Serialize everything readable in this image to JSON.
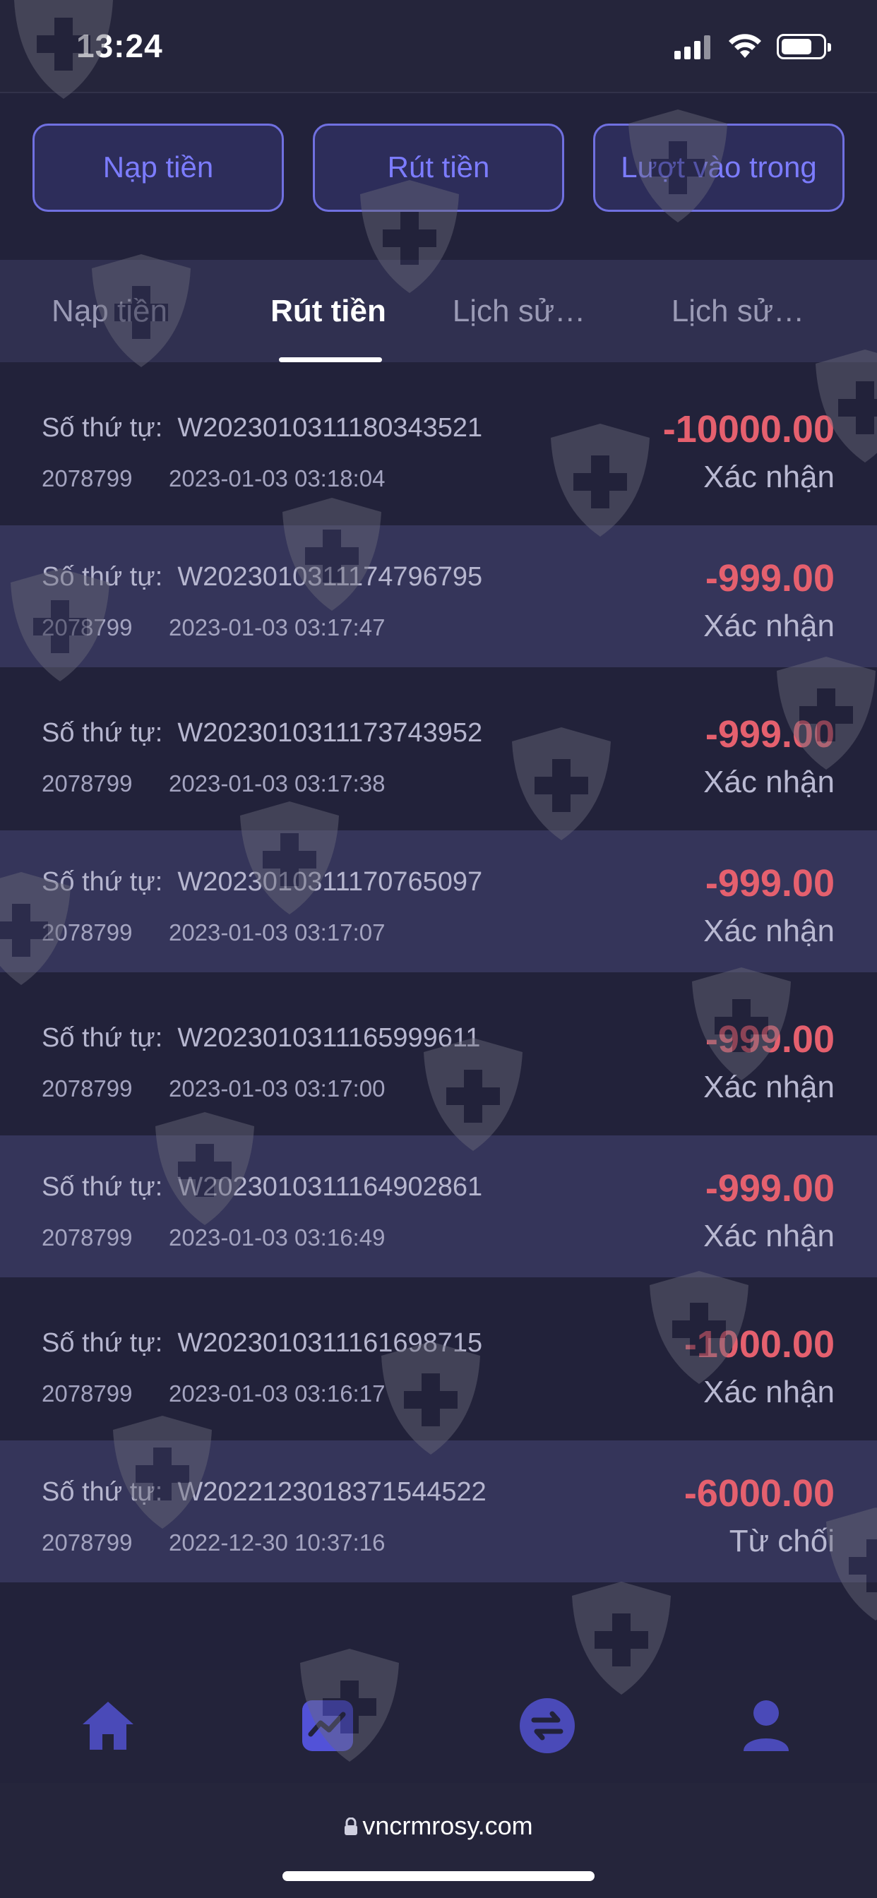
{
  "status_bar": {
    "time": "13:24"
  },
  "top_buttons": [
    {
      "label": "Nạp tiền"
    },
    {
      "label": "Rút tiền"
    },
    {
      "label": "Lượt vào trong"
    }
  ],
  "tabs": [
    {
      "label": "Nạp tiền",
      "active": false
    },
    {
      "label": "Rút tiền",
      "active": true
    },
    {
      "label": "Lịch sử…",
      "active": false
    },
    {
      "label": "Lịch sử…",
      "active": false
    }
  ],
  "order_prefix": "Số thứ tự:",
  "transactions": [
    {
      "order_id": "W2023010311180343521",
      "user_id": "2078799",
      "datetime": "2023-01-03 03:18:04",
      "amount": "-10000.00",
      "status": "Xác nhận"
    },
    {
      "order_id": "W2023010311174796795",
      "user_id": "2078799",
      "datetime": "2023-01-03 03:17:47",
      "amount": "-999.00",
      "status": "Xác nhận"
    },
    {
      "order_id": "W2023010311173743952",
      "user_id": "2078799",
      "datetime": "2023-01-03 03:17:38",
      "amount": "-999.00",
      "status": "Xác nhận"
    },
    {
      "order_id": "W2023010311170765097",
      "user_id": "2078799",
      "datetime": "2023-01-03 03:17:07",
      "amount": "-999.00",
      "status": "Xác nhận"
    },
    {
      "order_id": "W2023010311165999611",
      "user_id": "2078799",
      "datetime": "2023-01-03 03:17:00",
      "amount": "-999.00",
      "status": "Xác nhận"
    },
    {
      "order_id": "W2023010311164902861",
      "user_id": "2078799",
      "datetime": "2023-01-03 03:16:49",
      "amount": "-999.00",
      "status": "Xác nhận"
    },
    {
      "order_id": "W2023010311161698715",
      "user_id": "2078799",
      "datetime": "2023-01-03 03:16:17",
      "amount": "-1000.00",
      "status": "Xác nhận"
    },
    {
      "order_id": "W2022123018371544522",
      "user_id": "2078799",
      "datetime": "2022-12-30 10:37:16",
      "amount": "-6000.00",
      "status": "Từ chối"
    }
  ],
  "bottom_nav": [
    {
      "icon": "home-icon",
      "active": false
    },
    {
      "icon": "chart-icon",
      "active": true
    },
    {
      "icon": "exchange-icon",
      "active": false
    },
    {
      "icon": "user-icon",
      "active": false
    }
  ],
  "browser": {
    "url": "vncrmrosy.com"
  },
  "colors": {
    "accent": "#7c7cff",
    "negative_amount": "#e5606e",
    "background": "#22223a",
    "alt_row": "#35355a"
  }
}
